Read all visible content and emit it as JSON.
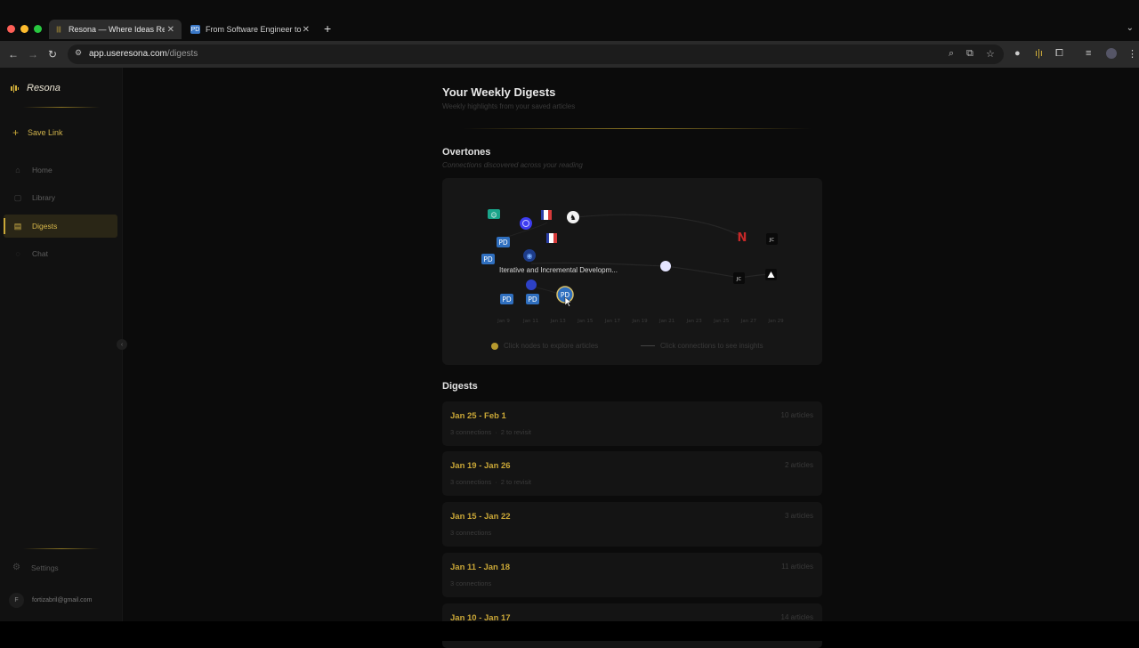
{
  "browser": {
    "tabs": [
      {
        "title": "Resona — Where Ideas Reson",
        "favicon": "resona-bars-icon",
        "active": true
      },
      {
        "title": "From Software Engineer to P",
        "favicon": "PD",
        "active": false
      }
    ],
    "url_host": "app.useresona.com",
    "url_path": "/digests"
  },
  "sidebar": {
    "brand": "Resona",
    "save_link": "Save Link",
    "items": [
      {
        "label": "Home",
        "icon": "home-icon"
      },
      {
        "label": "Library",
        "icon": "book-icon"
      },
      {
        "label": "Digests",
        "icon": "newspaper-icon",
        "active": true
      },
      {
        "label": "Chat",
        "icon": "chat-icon"
      }
    ],
    "settings": "Settings",
    "user_initial": "F",
    "user_email": "fortizabril@gmail.com"
  },
  "main": {
    "title": "Your Weekly Digests",
    "subtitle": "Weekly highlights from your saved articles",
    "overtones": {
      "title": "Overtones",
      "subtitle": "Connections discovered across your reading",
      "tooltip": "Iterative and Incremental Developm...",
      "axis_ticks": [
        "Jan 9",
        "Jan 11",
        "Jan 13",
        "Jan 15",
        "Jan 17",
        "Jan 19",
        "Jan 21",
        "Jan 23",
        "Jan 25",
        "Jan 27",
        "Jan 29"
      ],
      "legend_nodes": "Click nodes to explore articles",
      "legend_connections": "Click connections to see insights",
      "node_labels": {
        "pd": "PD",
        "jc": "JC",
        "n": "N"
      }
    },
    "digests_title": "Digests",
    "digests": [
      {
        "range": "Jan 25 - Feb 1",
        "count": "10 articles",
        "meta": [
          "3 connections",
          "2 to revisit"
        ]
      },
      {
        "range": "Jan 19 - Jan 26",
        "count": "2 articles",
        "meta": [
          "3 connections",
          "2 to revisit"
        ]
      },
      {
        "range": "Jan 15 - Jan 22",
        "count": "3 articles",
        "meta": [
          "3 connections"
        ]
      },
      {
        "range": "Jan 11 - Jan 18",
        "count": "11 articles",
        "meta": [
          "3 connections"
        ]
      },
      {
        "range": "Jan 10 - Jan 17",
        "count": "14 articles",
        "meta": []
      }
    ]
  },
  "colors": {
    "accent": "#c9a838",
    "background": "#0b0b0b",
    "card": "#161616"
  }
}
